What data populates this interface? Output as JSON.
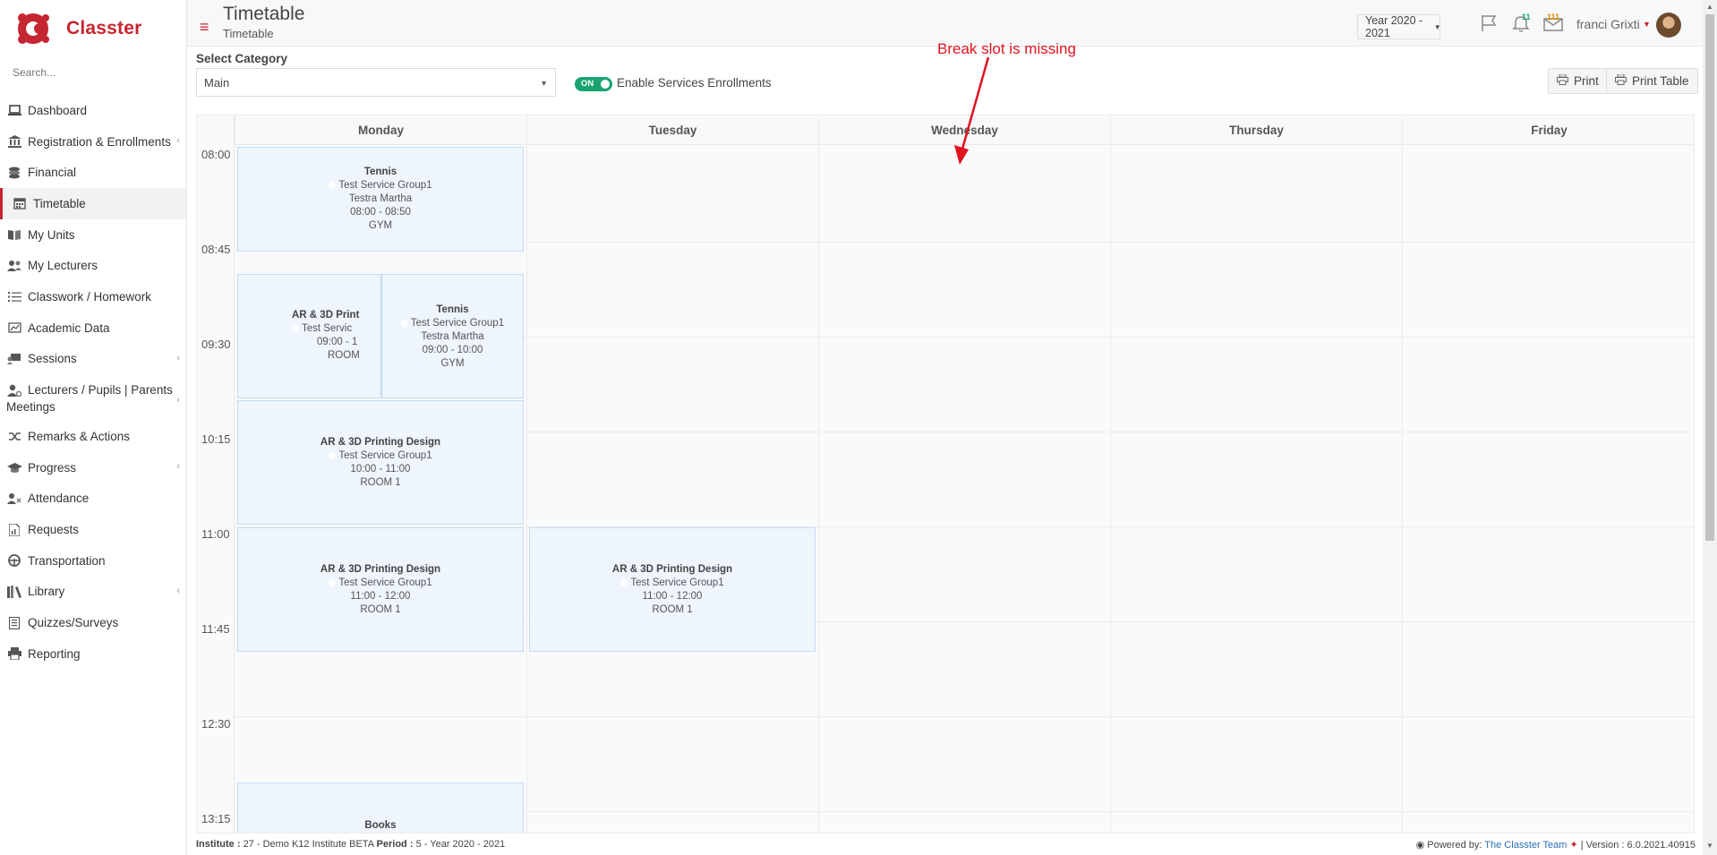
{
  "app": {
    "name": "Classter",
    "brand_color": "#c62631"
  },
  "sidebar": {
    "search_placeholder": "Search...",
    "items": [
      {
        "label": "Dashboard",
        "icon": "laptop-icon",
        "caret": false,
        "active": false
      },
      {
        "label": "Registration & Enrollments",
        "icon": "institution-icon",
        "caret": true,
        "active": false
      },
      {
        "label": "Financial",
        "icon": "coins-icon",
        "caret": false,
        "active": false
      },
      {
        "label": "Timetable",
        "icon": "calendar-icon",
        "caret": false,
        "active": true
      },
      {
        "label": "My Units",
        "icon": "book-icon",
        "caret": false,
        "active": false
      },
      {
        "label": "My Lecturers",
        "icon": "users-icon",
        "caret": false,
        "active": false
      },
      {
        "label": "Classwork / Homework",
        "icon": "tasks-icon",
        "caret": false,
        "active": false
      },
      {
        "label": "Academic Data",
        "icon": "chart-board-icon",
        "caret": false,
        "active": false
      },
      {
        "label": "Sessions",
        "icon": "sessions-icon",
        "caret": true,
        "active": false
      },
      {
        "label": "Lecturers / Pupils | Parents Meetings",
        "icon": "user-gear-icon",
        "caret": true,
        "active": false
      },
      {
        "label": "Remarks & Actions",
        "icon": "shuffle-icon",
        "caret": false,
        "active": false
      },
      {
        "label": "Progress",
        "icon": "graduation-cap-icon",
        "caret": true,
        "active": false
      },
      {
        "label": "Attendance",
        "icon": "user-x-icon",
        "caret": false,
        "active": false
      },
      {
        "label": "Requests",
        "icon": "file-chart-icon",
        "caret": false,
        "active": false
      },
      {
        "label": "Transportation",
        "icon": "steering-wheel-icon",
        "caret": false,
        "active": false
      },
      {
        "label": "Library",
        "icon": "books-icon",
        "caret": true,
        "active": false
      },
      {
        "label": "Quizzes/Surveys",
        "icon": "list-file-icon",
        "caret": false,
        "active": false
      },
      {
        "label": "Reporting",
        "icon": "printer-icon",
        "caret": false,
        "active": false
      }
    ]
  },
  "header": {
    "title": "Timetable",
    "subtitle": "Timetable",
    "year": "Year 2020 - 2021",
    "notifications_count": "11",
    "messages_count": "111",
    "user": "franci Grixti"
  },
  "controls": {
    "category_label": "Select Category",
    "category_value": "Main",
    "toggle_state": "ON",
    "toggle_label": "Enable Services Enrollments",
    "print_label": "Print",
    "print_table_label": "Print Table"
  },
  "annotation": "Break slot is missing",
  "timetable": {
    "days": [
      "Monday",
      "Tuesday",
      "Wednesday",
      "Thursday",
      "Friday"
    ],
    "times": [
      "08:00",
      "08:45",
      "09:30",
      "10:15",
      "11:00",
      "11:45",
      "12:30",
      "13:15"
    ],
    "events": [
      {
        "title": "Tennis",
        "group": "Test Service Group1",
        "lecturer": "Testra Martha",
        "time": "08:00 - 08:50",
        "room": "GYM"
      },
      {
        "title": "AR & 3D Print",
        "group": "Test Servic",
        "lecturer": "",
        "time": "09:00 - 1",
        "room": "ROOM"
      },
      {
        "title": "Tennis",
        "group": "Test Service Group1",
        "lecturer": "Testra Martha",
        "time": "09:00 - 10:00",
        "room": "GYM"
      },
      {
        "title": "AR & 3D Printing Design",
        "group": "Test Service Group1",
        "lecturer": "",
        "time": "10:00 - 11:00",
        "room": "ROOM 1"
      },
      {
        "title": "AR & 3D Printing Design",
        "group": "Test Service Group1",
        "lecturer": "",
        "time": "11:00 - 12:00",
        "room": "ROOM 1"
      },
      {
        "title": "AR & 3D Printing Design",
        "group": "Test Service Group1",
        "lecturer": "",
        "time": "11:00 - 12:00",
        "room": "ROOM 1"
      },
      {
        "title": "Books",
        "group": "",
        "lecturer": "",
        "time": "",
        "room": ""
      }
    ]
  },
  "footer": {
    "institute_label": "Institute :",
    "institute_value": "27 - Demo K12 Institute BETA",
    "period_label": "Period :",
    "period_value": "5 - Year 2020 - 2021",
    "powered_label": "Powered by:",
    "powered_link": "The Classter Team",
    "version_text": "| Version : 6.0.2021.40915"
  }
}
